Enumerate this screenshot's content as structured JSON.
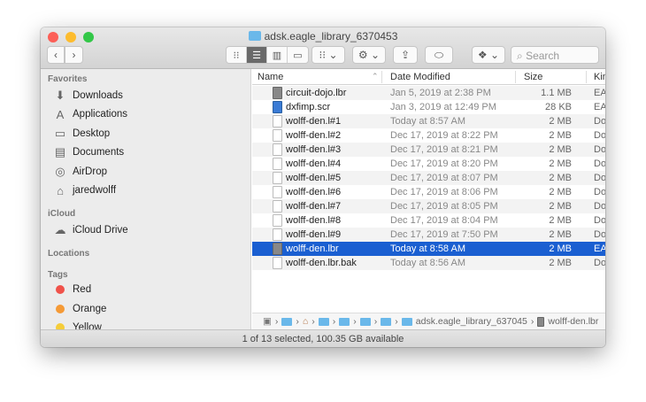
{
  "window": {
    "title": "adsk.eagle_library_6370453"
  },
  "toolbar": {
    "back": "‹",
    "forward": "›",
    "view_icons": [
      "icon-view",
      "list-view",
      "column-view",
      "gallery-view"
    ],
    "group": "group-icon",
    "action": "gear-icon",
    "share": "share-icon",
    "tag": "tag-icon",
    "dropbox": "dropbox-icon",
    "search_placeholder": "Search"
  },
  "sidebar": {
    "favorites_label": "Favorites",
    "favorites": [
      {
        "label": "Downloads",
        "icon": "⬇"
      },
      {
        "label": "Applications",
        "icon": "A"
      },
      {
        "label": "Desktop",
        "icon": "▭"
      },
      {
        "label": "Documents",
        "icon": "▤"
      },
      {
        "label": "AirDrop",
        "icon": "◎"
      },
      {
        "label": "jaredwolff",
        "icon": "⌂"
      }
    ],
    "icloud_label": "iCloud",
    "icloud": [
      {
        "label": "iCloud Drive",
        "icon": "☁"
      }
    ],
    "locations_label": "Locations",
    "tags_label": "Tags",
    "tags": [
      {
        "label": "Red",
        "color": "#f0524a"
      },
      {
        "label": "Orange",
        "color": "#f59a36"
      },
      {
        "label": "Yellow",
        "color": "#f5cd3a"
      }
    ]
  },
  "list": {
    "columns": {
      "name": "Name",
      "date": "Date Modified",
      "size": "Size",
      "kind": "Kin"
    },
    "rows": [
      {
        "name": "circuit-dojo.lbr",
        "date": "Jan 5, 2019 at 2:38 PM",
        "size": "1.1 MB",
        "kind": "EA",
        "type": "lbr"
      },
      {
        "name": "dxfimp.scr",
        "date": "Jan 3, 2019 at 12:49 PM",
        "size": "28 KB",
        "kind": "EA",
        "type": "scr"
      },
      {
        "name": "wolff-den.l#1",
        "date": "Today at 8:57 AM",
        "size": "2 MB",
        "kind": "Do",
        "type": "doc"
      },
      {
        "name": "wolff-den.l#2",
        "date": "Dec 17, 2019 at 8:22 PM",
        "size": "2 MB",
        "kind": "Do",
        "type": "doc"
      },
      {
        "name": "wolff-den.l#3",
        "date": "Dec 17, 2019 at 8:21 PM",
        "size": "2 MB",
        "kind": "Do",
        "type": "doc"
      },
      {
        "name": "wolff-den.l#4",
        "date": "Dec 17, 2019 at 8:20 PM",
        "size": "2 MB",
        "kind": "Do",
        "type": "doc"
      },
      {
        "name": "wolff-den.l#5",
        "date": "Dec 17, 2019 at 8:07 PM",
        "size": "2 MB",
        "kind": "Do",
        "type": "doc"
      },
      {
        "name": "wolff-den.l#6",
        "date": "Dec 17, 2019 at 8:06 PM",
        "size": "2 MB",
        "kind": "Do",
        "type": "doc"
      },
      {
        "name": "wolff-den.l#7",
        "date": "Dec 17, 2019 at 8:05 PM",
        "size": "2 MB",
        "kind": "Do",
        "type": "doc"
      },
      {
        "name": "wolff-den.l#8",
        "date": "Dec 17, 2019 at 8:04 PM",
        "size": "2 MB",
        "kind": "Do",
        "type": "doc"
      },
      {
        "name": "wolff-den.l#9",
        "date": "Dec 17, 2019 at 7:50 PM",
        "size": "2 MB",
        "kind": "Do",
        "type": "doc"
      },
      {
        "name": "wolff-den.lbr",
        "date": "Today at 8:58 AM",
        "size": "2 MB",
        "kind": "EA",
        "type": "lbr",
        "selected": true
      },
      {
        "name": "wolff-den.lbr.bak",
        "date": "Today at 8:56 AM",
        "size": "2 MB",
        "kind": "Do",
        "type": "doc"
      }
    ]
  },
  "pathbar": {
    "folder": "adsk.eagle_library_637045",
    "file": "wolff-den.lbr"
  },
  "status": "1 of 13 selected, 100.35 GB available"
}
